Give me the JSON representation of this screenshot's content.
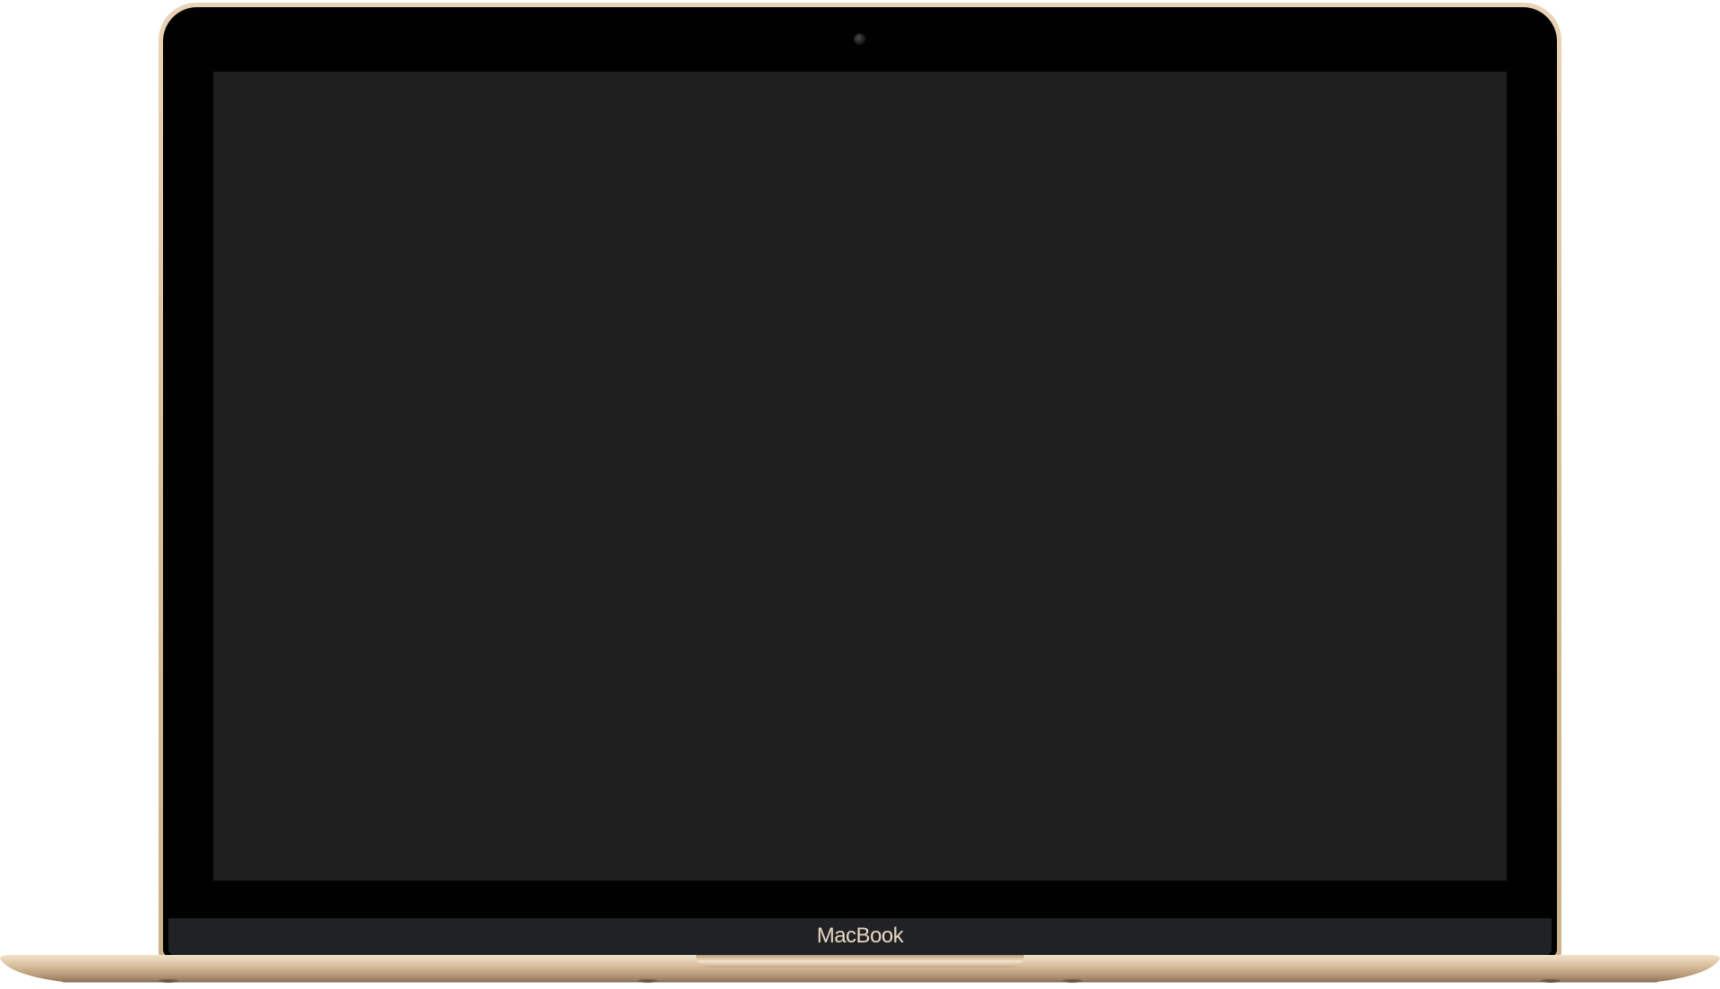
{
  "device": {
    "model_label": "MacBook",
    "colors": {
      "lid_rim": "#dcc3a0",
      "bezel": "#010101",
      "screen": "#1e1e1e",
      "chin": "#202225",
      "label": "#e8d7c2",
      "base": "#d8bf9d"
    }
  }
}
